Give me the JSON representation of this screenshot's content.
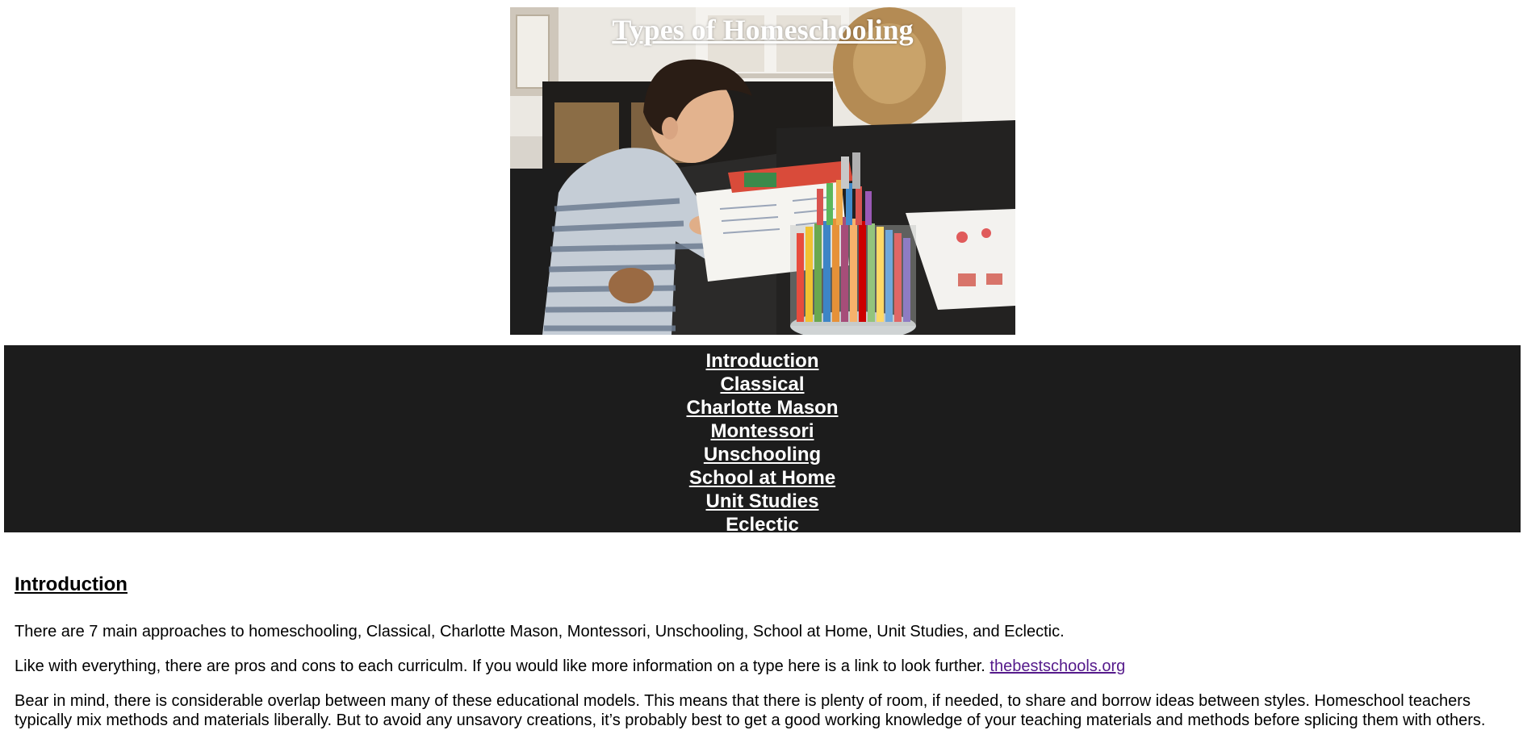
{
  "header": {
    "title": "Types of Homeschooling",
    "image_alt": "Boy coloring at a table with a jar of crayons"
  },
  "nav": {
    "items": [
      {
        "label": "Introduction"
      },
      {
        "label": "Classical"
      },
      {
        "label": "Charlotte Mason"
      },
      {
        "label": "Montessori"
      },
      {
        "label": "Unschooling"
      },
      {
        "label": "School at Home"
      },
      {
        "label": "Unit Studies"
      },
      {
        "label": "Eclectic"
      }
    ]
  },
  "intro": {
    "heading": "Introduction",
    "p1": "There are 7 main approaches to homeschooling, Classical, Charlotte Mason, Montessori, Unschooling, School at Home, Unit Studies, and Eclectic.",
    "p2_text": "Like with everything, there are pros and cons to each curriculm. If you would like more information on a type here is a link to look further.",
    "p2_link": "thebestschools.org",
    "p3": "Bear in mind, there is considerable overlap between many of these educational models. This means that there is plenty of room, if needed, to share and borrow ideas between styles. Homeschool teachers typically mix methods and materials liberally. But to avoid any unsavory creations, it’s probably best to get a good working knowledge of your teaching materials and methods before splicing them with others."
  },
  "colors": {
    "nav_background": "#1c1c1c",
    "nav_text": "#ffffff",
    "visited_link": "#551a8b"
  }
}
